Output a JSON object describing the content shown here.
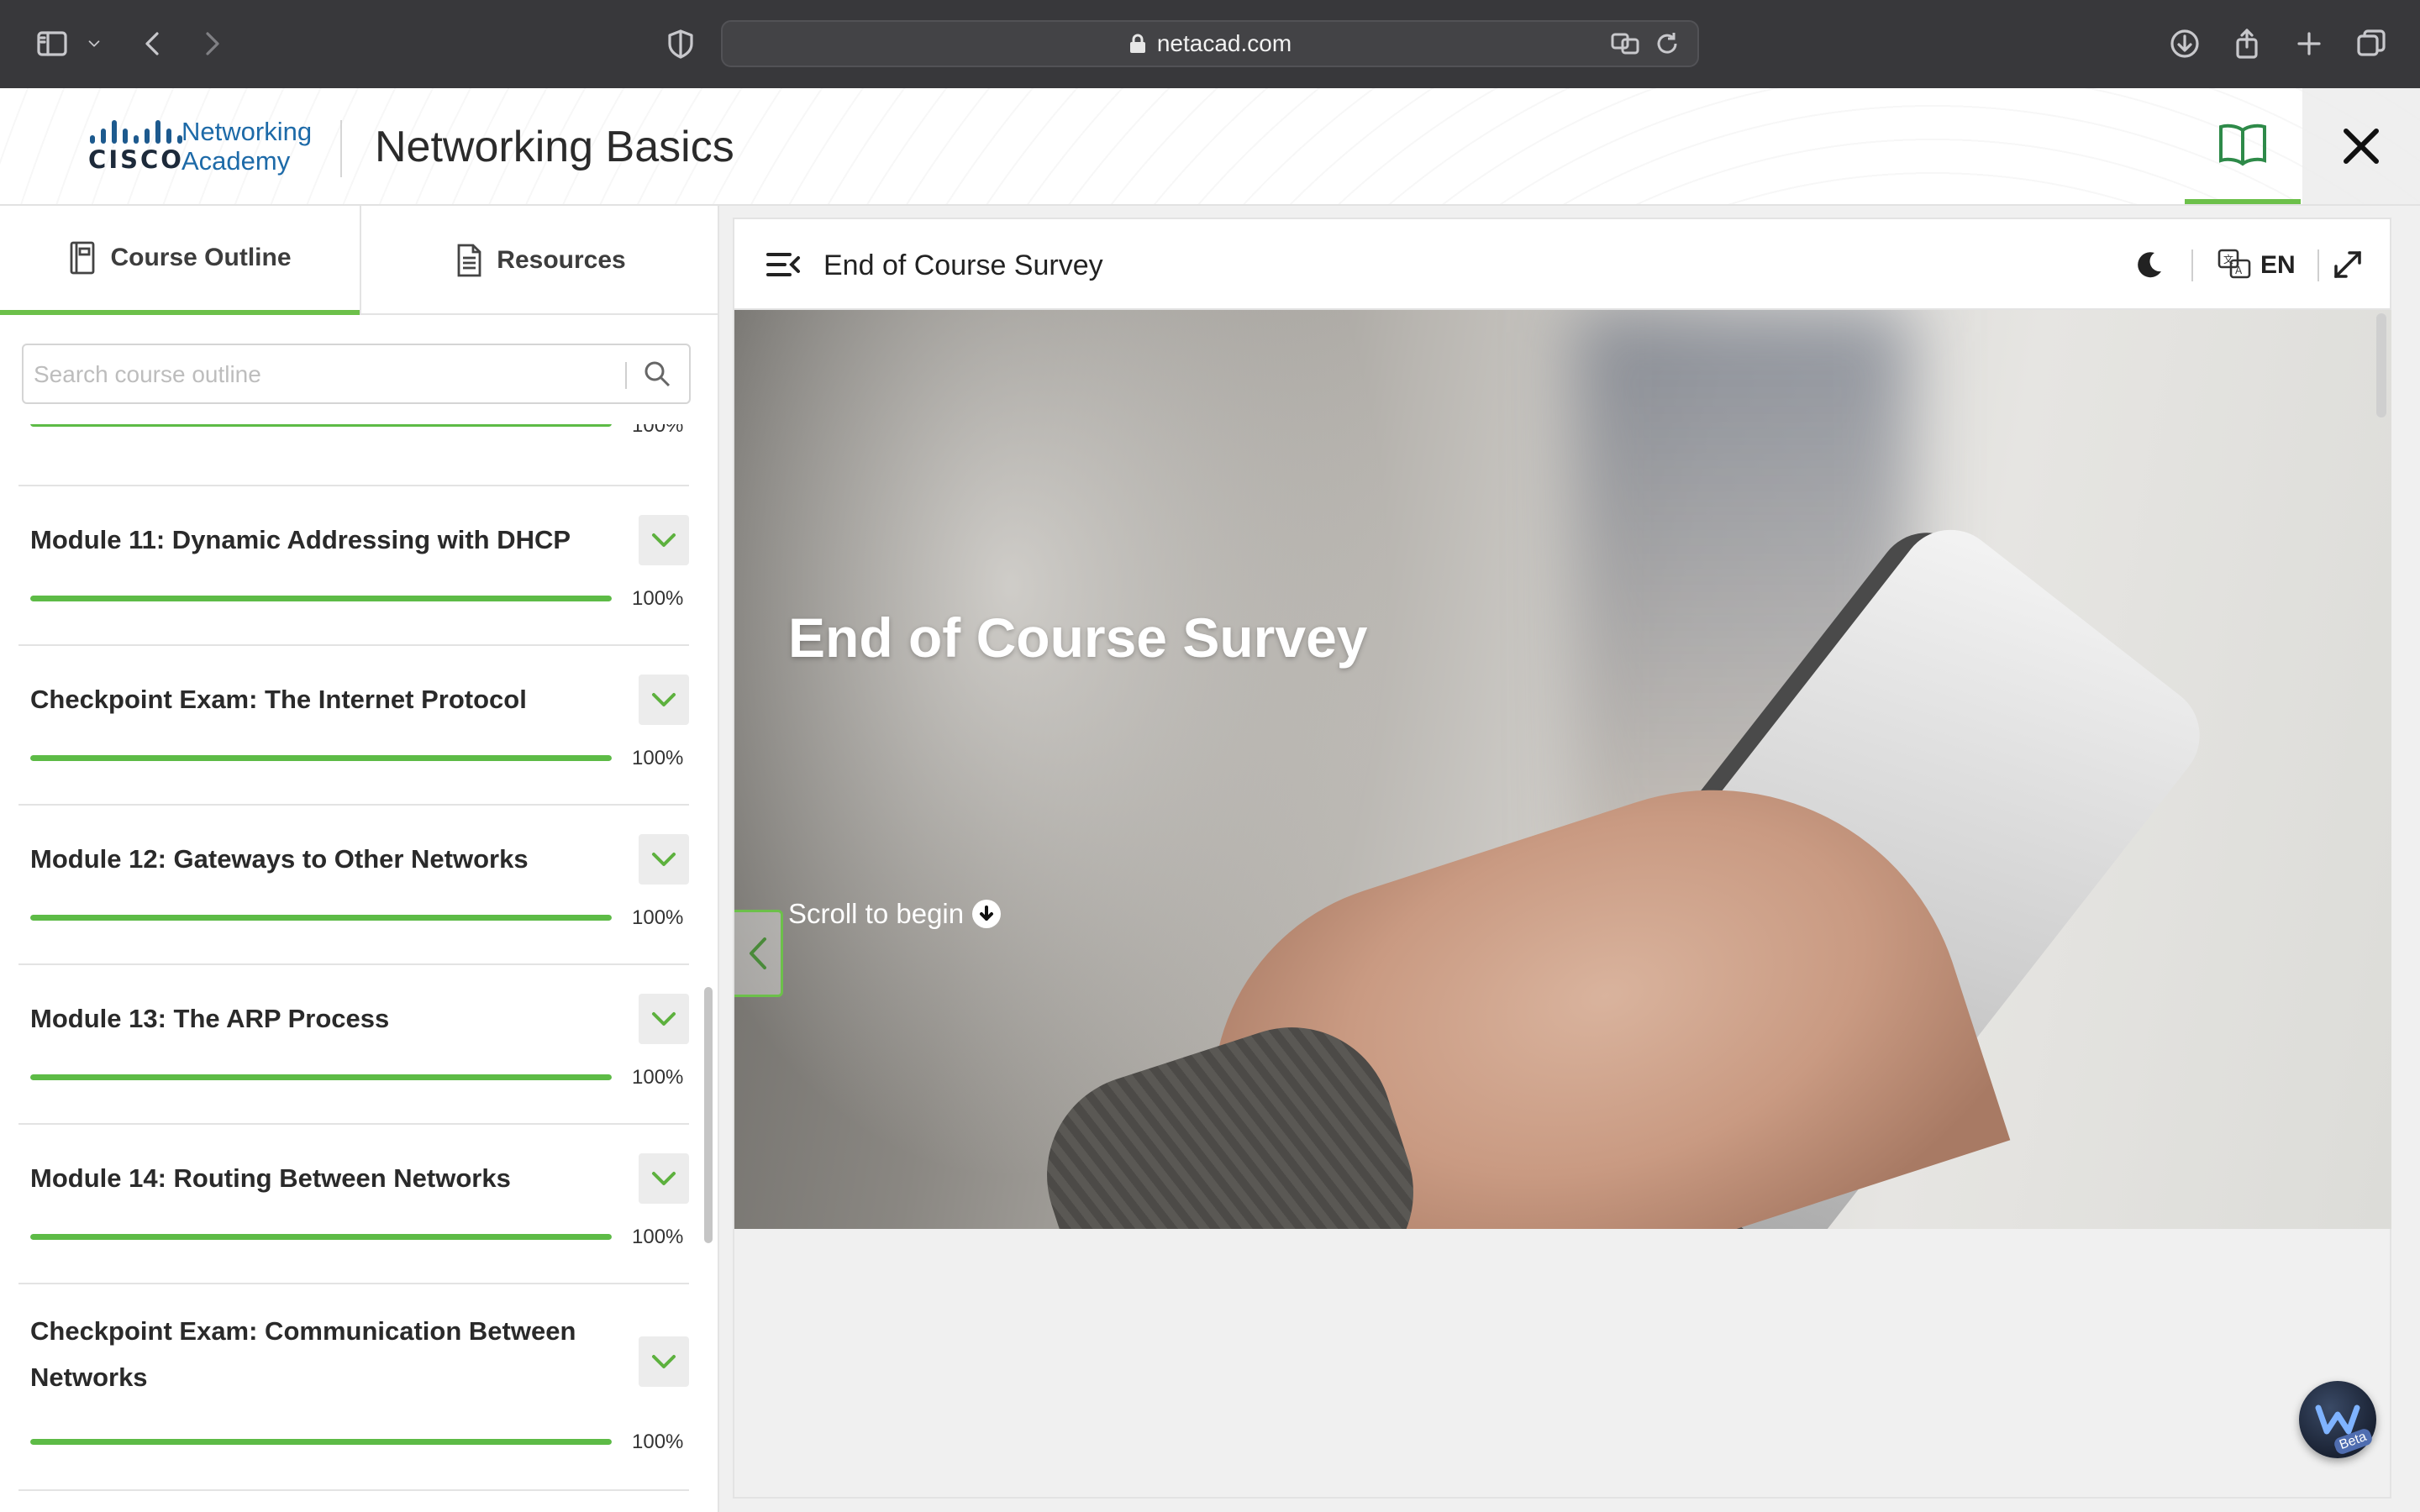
{
  "browser": {
    "url": "netacad.com",
    "icons": [
      "sidebar-icon",
      "chevron-down-icon",
      "back-icon",
      "forward-icon",
      "shield-icon",
      "lock-icon",
      "translate-icon",
      "reload-icon",
      "download-icon",
      "share-icon",
      "new-tab-icon",
      "tabs-overview-icon"
    ]
  },
  "header": {
    "logo_wordmark": "CISCO",
    "academy_line1": "Networking",
    "academy_line2": "Academy",
    "course_title": "Networking Basics"
  },
  "sidebar": {
    "tabs": [
      {
        "label": "Course Outline",
        "icon": "outline-icon",
        "active": true
      },
      {
        "label": "Resources",
        "icon": "document-icon",
        "active": false
      }
    ],
    "search_placeholder": "Search course outline",
    "partial_progress_label": "100%",
    "modules": [
      {
        "title": "Module 11: Dynamic Addressing with DHCP",
        "progress": 100,
        "progress_label": "100%"
      },
      {
        "title": "Checkpoint Exam: The Internet Protocol",
        "progress": 100,
        "progress_label": "100%"
      },
      {
        "title": "Module 12: Gateways to Other Networks",
        "progress": 100,
        "progress_label": "100%"
      },
      {
        "title": "Module 13: The ARP Process",
        "progress": 100,
        "progress_label": "100%"
      },
      {
        "title": "Module 14: Routing Between Networks",
        "progress": 100,
        "progress_label": "100%"
      },
      {
        "title": "Checkpoint Exam: Communication Between Networks",
        "progress": 100,
        "progress_label": "100%"
      }
    ]
  },
  "content": {
    "page_title": "End of Course Survey",
    "language": "EN",
    "hero_title": "End of Course Survey",
    "scroll_hint": "Scroll to begin",
    "assistant_badge": "Beta"
  },
  "colors": {
    "accent_green": "#6cc04a",
    "progress_green": "#5dbb46",
    "browser_chrome": "#38383b",
    "cisco_blue": "#1d6aa8"
  }
}
